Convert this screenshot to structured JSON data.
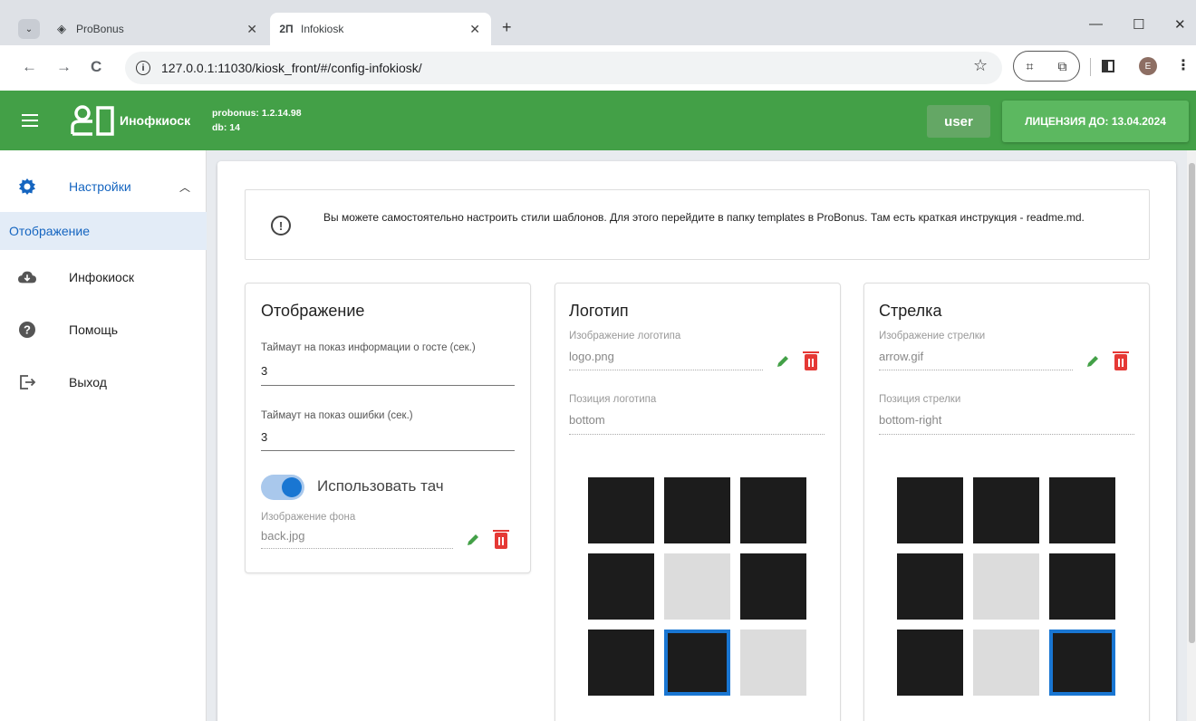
{
  "browser": {
    "tabs": [
      {
        "title": "ProBonus",
        "active": false
      },
      {
        "title": "Infokiosk",
        "active": true
      }
    ],
    "url": "127.0.0.1:11030/kiosk_front/#/config-infokiosk/",
    "avatar_letter": "E"
  },
  "header": {
    "title": "Инофкиоск",
    "version_line": "probonus: 1.2.14.98",
    "db_line": "db: 14",
    "user_label": "user",
    "license_label": "ЛИЦЕНЗИЯ ДО: 13.04.2024",
    "color": "#43a047"
  },
  "sidebar": {
    "items": [
      {
        "label": "Настройки",
        "icon": "gear-icon",
        "expanded": true
      },
      {
        "label": "Инфокиоск",
        "icon": "cloud-icon"
      },
      {
        "label": "Помощь",
        "icon": "help-icon"
      },
      {
        "label": "Выход",
        "icon": "logout-icon"
      }
    ],
    "sub_items": [
      {
        "label": "Отображение",
        "active": true
      }
    ]
  },
  "alert": {
    "text": "Вы можете самостоятельно настроить стили шаблонов. Для этого перейдите в папку templates в ProBonus. Там есть краткая инструкция - readme.md."
  },
  "display_card": {
    "title": "Отображение",
    "guest_timeout_label": "Таймаут на показ информации о госте (сек.)",
    "guest_timeout_value": "3",
    "error_timeout_label": "Таймаут на показ ошибки (сек.)",
    "error_timeout_value": "3",
    "touch_label": "Использовать тач",
    "touch_enabled": true,
    "bg_image_label": "Изображение фона",
    "bg_image_value": "back.jpg"
  },
  "logo_card": {
    "title": "Логотип",
    "image_label": "Изображение логотипа",
    "image_value": "logo.png",
    "position_label": "Позиция логотипа",
    "position_value": "bottom",
    "grid": [
      "dark",
      "dark",
      "dark",
      "dark",
      "light",
      "dark",
      "dark",
      "selected",
      "light"
    ]
  },
  "arrow_card": {
    "title": "Стрелка",
    "image_label": "Изображение стрелки",
    "image_value": "arrow.gif",
    "position_label": "Позиция стрелки",
    "position_value": "bottom-right",
    "grid": [
      "dark",
      "dark",
      "dark",
      "dark",
      "light",
      "dark",
      "dark",
      "light",
      "selected"
    ]
  }
}
